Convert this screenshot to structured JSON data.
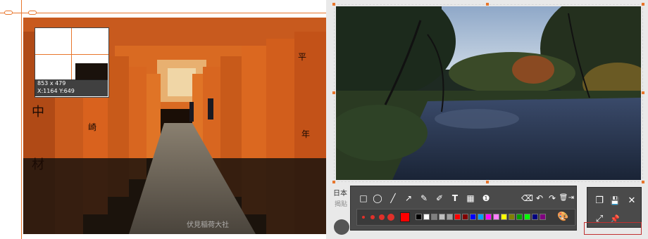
{
  "magnifier": {
    "size_text": "853 x 479",
    "coords_text": "X:1164 Y:649"
  },
  "left_photo": {
    "overlay_caption": "伏見稲荷大社"
  },
  "page_behind": {
    "text_line_1": "日本",
    "text_line_2": "揭贴"
  },
  "draw_tools": [
    {
      "name": "rectangle-tool",
      "glyph": "□"
    },
    {
      "name": "ellipse-tool",
      "glyph": "◯"
    },
    {
      "name": "line-tool",
      "glyph": "╱"
    },
    {
      "name": "arrow-tool",
      "glyph": "↗"
    },
    {
      "name": "pen-tool",
      "glyph": "✎"
    },
    {
      "name": "marker-tool",
      "glyph": "✐"
    },
    {
      "name": "text-tool",
      "glyph": "T"
    },
    {
      "name": "mosaic-tool",
      "glyph": "▦"
    },
    {
      "name": "number-tool",
      "glyph": "❶"
    }
  ],
  "edit_tools": [
    {
      "name": "eraser-tool",
      "glyph": "⌫"
    },
    {
      "name": "undo-tool",
      "glyph": "↶"
    },
    {
      "name": "redo-tool",
      "glyph": "↷"
    },
    {
      "name": "delete-tool",
      "glyph": "🗑"
    },
    {
      "name": "exit-tool",
      "glyph": "⇥"
    }
  ],
  "style": {
    "current_color": "#ff0000",
    "palette": [
      "#000000",
      "#ffffff",
      "#808080",
      "#c0c0c0",
      "#a0a0a0",
      "#ff0000",
      "#800000",
      "#0000ff",
      "#00a0ff",
      "#ff00ff",
      "#ff80ff",
      "#ffff00",
      "#808000",
      "#00a000",
      "#00ff00",
      "#000080",
      "#800080"
    ]
  },
  "actions": [
    {
      "name": "copy-icon",
      "glyph": "❐"
    },
    {
      "name": "save-icon",
      "glyph": "💾"
    },
    {
      "name": "close-icon",
      "glyph": "✕"
    },
    {
      "name": "fullscreen-icon",
      "glyph": "⤢"
    },
    {
      "name": "pin-icon",
      "glyph": "📌"
    }
  ],
  "colors": {
    "accent": "#e8762c",
    "toolbar_bg": "#4a4a4a"
  }
}
